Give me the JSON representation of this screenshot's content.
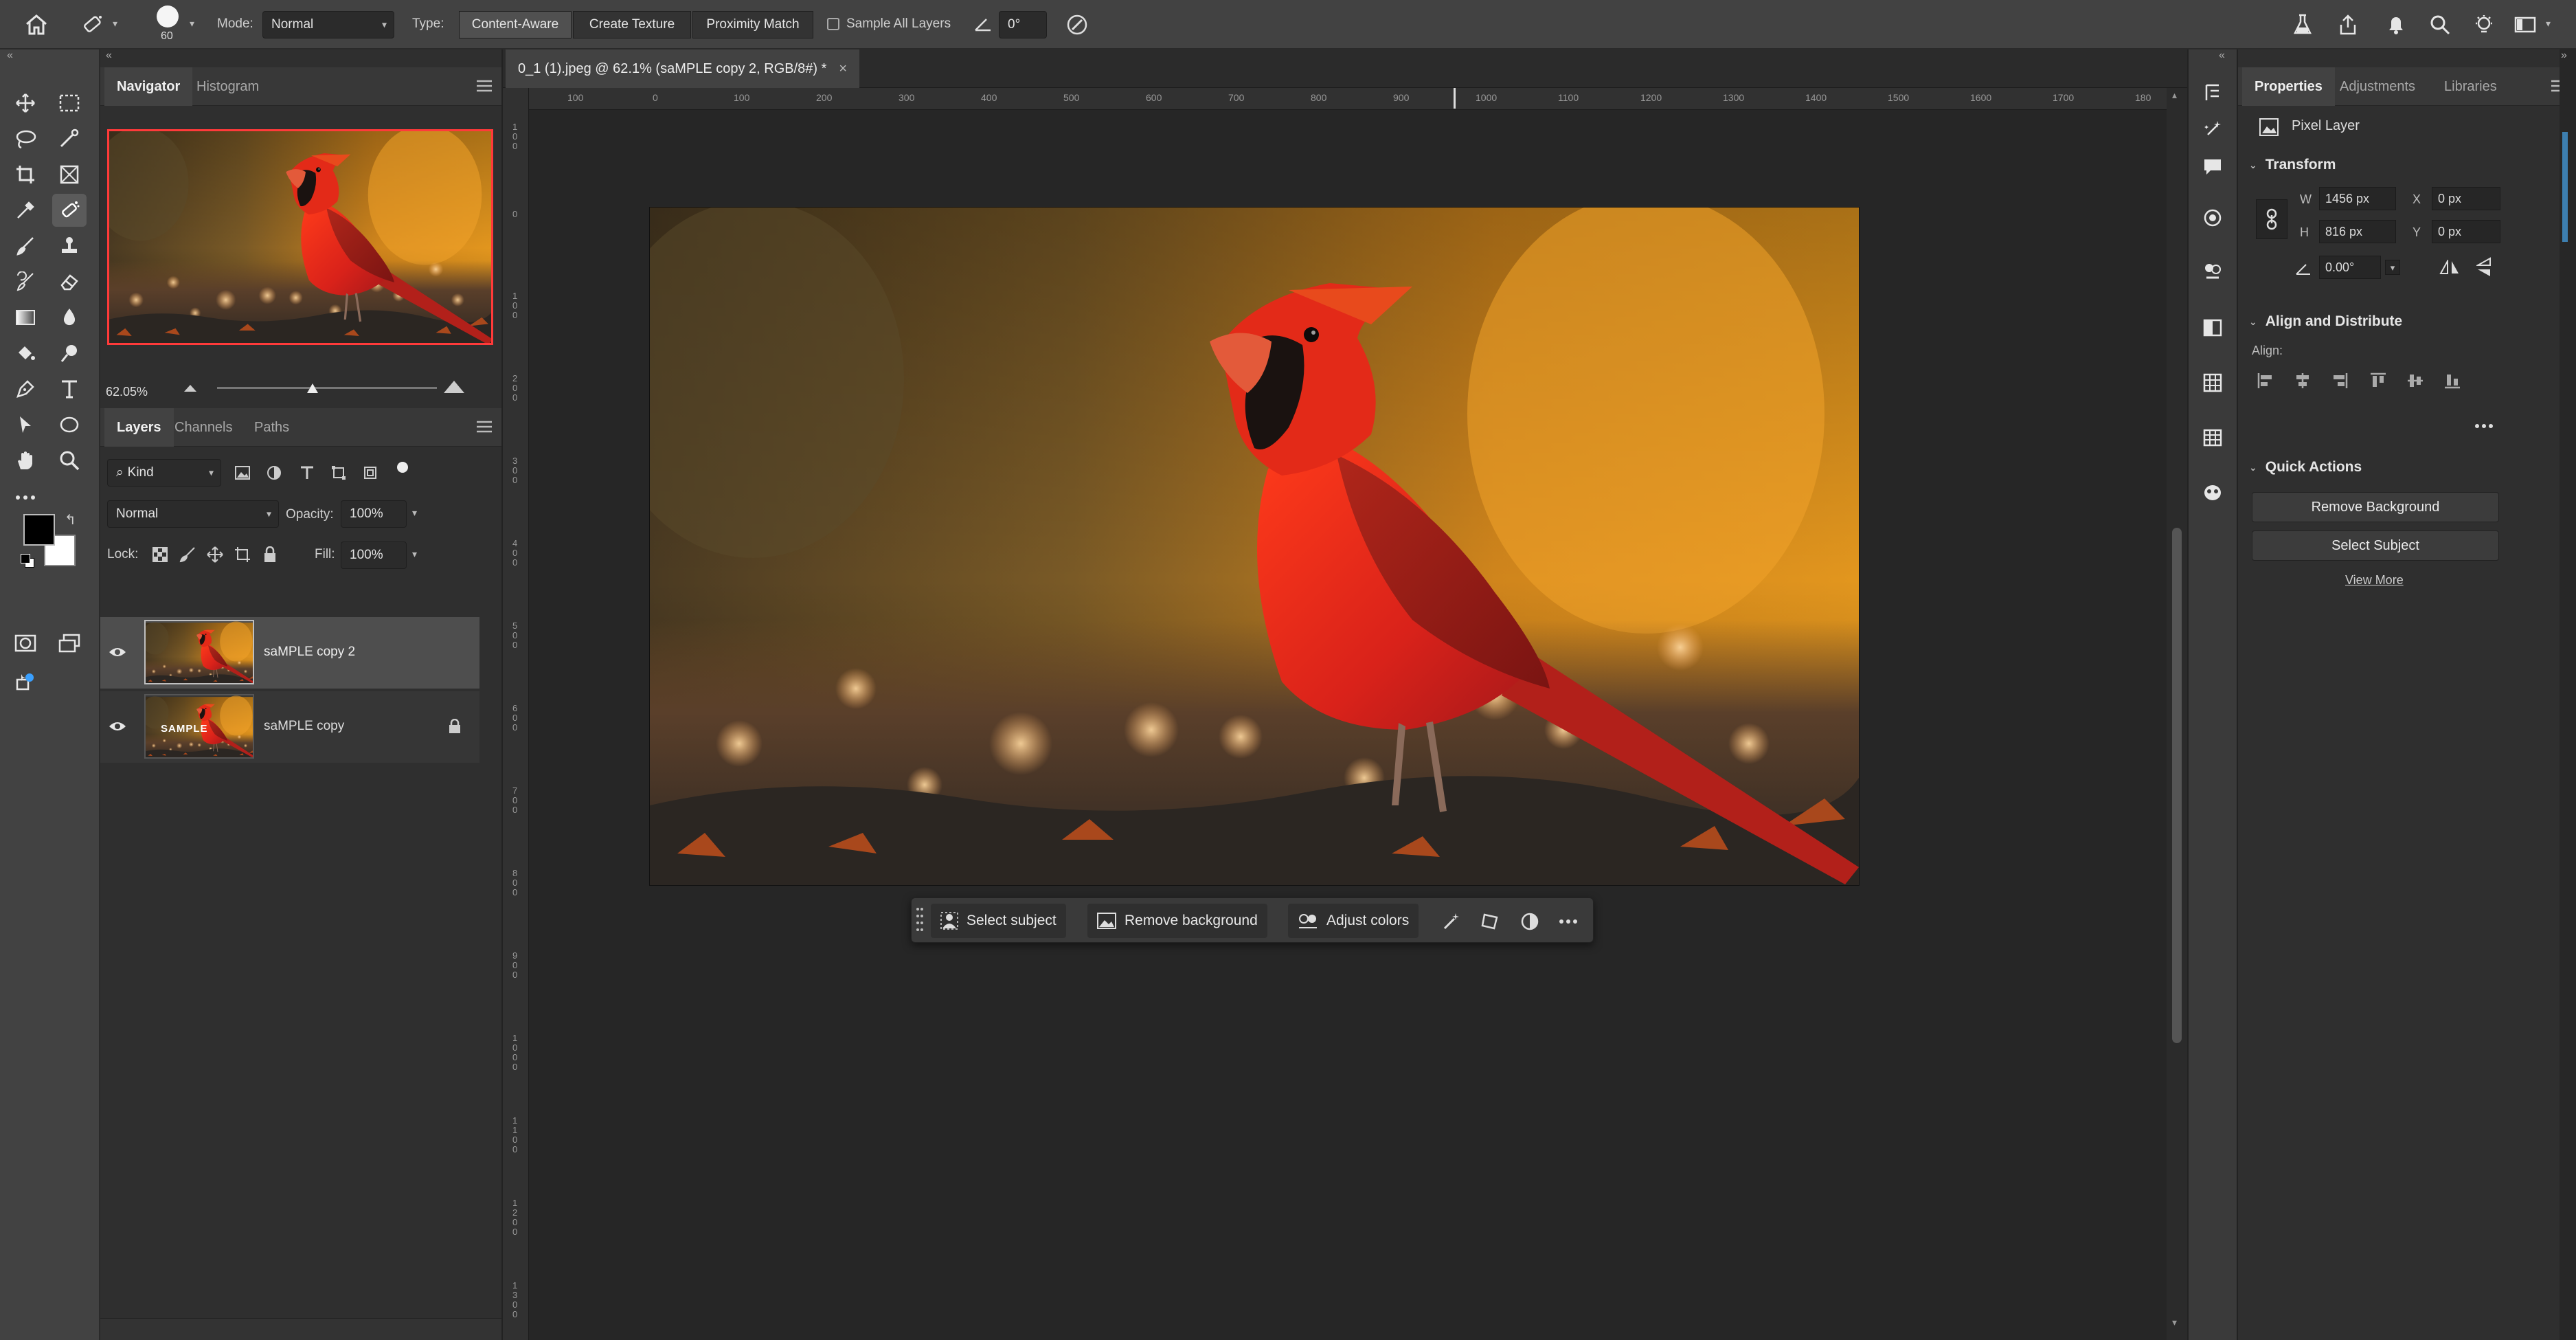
{
  "options_bar": {
    "brush_size": "60",
    "mode_label": "Mode:",
    "mode_value": "Normal",
    "type_label": "Type:",
    "type_options": [
      "Content-Aware",
      "Create Texture",
      "Proximity Match"
    ],
    "sample_all_layers": "Sample All Layers",
    "angle_value": "0°"
  },
  "navigator": {
    "tabs": [
      "Navigator",
      "Histogram"
    ],
    "zoom": "62.05%"
  },
  "layers_panel": {
    "tabs": [
      "Layers",
      "Channels",
      "Paths"
    ],
    "filter_kind": "Kind",
    "blend_mode": "Normal",
    "opacity_label": "Opacity:",
    "opacity_value": "100%",
    "lock_label": "Lock:",
    "fill_label": "Fill:",
    "fill_value": "100%",
    "layers": [
      {
        "name": "saMPLE copy 2",
        "thumb_watermark": "",
        "selected": true
      },
      {
        "name": "saMPLE copy",
        "thumb_watermark": "SAMPLE",
        "locked": true
      }
    ]
  },
  "document": {
    "tab_title": "0_1 (1).jpeg @ 62.1% (saMPLE copy 2, RGB/8#) *",
    "ruler_labels": [
      "100",
      "0",
      "100",
      "200",
      "300",
      "400",
      "500",
      "600",
      "700",
      "800",
      "900",
      "1000",
      "1100",
      "1200",
      "1300",
      "1400",
      "1500",
      "1600",
      "1700",
      "180"
    ],
    "vruler_labels": [
      "1\n0\n0",
      "0",
      "1\n0\n0",
      "2\n0\n0",
      "3\n0\n0",
      "4\n0\n0",
      "5\n0\n0",
      "6\n0\n0",
      "7\n0\n0",
      "8\n0\n0",
      "9\n0\n0",
      "1\n0\n0\n0",
      "1\n1\n0\n0",
      "1\n2\n0\n0",
      "1\n3\n0\n0"
    ]
  },
  "context_bar": {
    "select_subject": "Select subject",
    "remove_background": "Remove background",
    "adjust_colors": "Adjust colors"
  },
  "properties": {
    "tabs": [
      "Properties",
      "Adjustments",
      "Libraries"
    ],
    "layer_kind": "Pixel Layer",
    "transform_title": "Transform",
    "w_label": "W",
    "w_value": "1456 px",
    "h_label": "H",
    "h_value": "816 px",
    "x_label": "X",
    "x_value": "0 px",
    "y_label": "Y",
    "y_value": "0 px",
    "angle_value": "0.00°",
    "align_title": "Align and Distribute",
    "align_label": "Align:",
    "quick_actions_title": "Quick Actions",
    "remove_background": "Remove Background",
    "select_subject": "Select Subject",
    "view_more": "View More"
  },
  "colors": {
    "ui_dark": "#2f2f2f",
    "ui_mid": "#424242",
    "cardinal_red": "#d8261a",
    "bokeh_orange": "#e8921e",
    "nav_highlight": "#ff3a3a"
  }
}
